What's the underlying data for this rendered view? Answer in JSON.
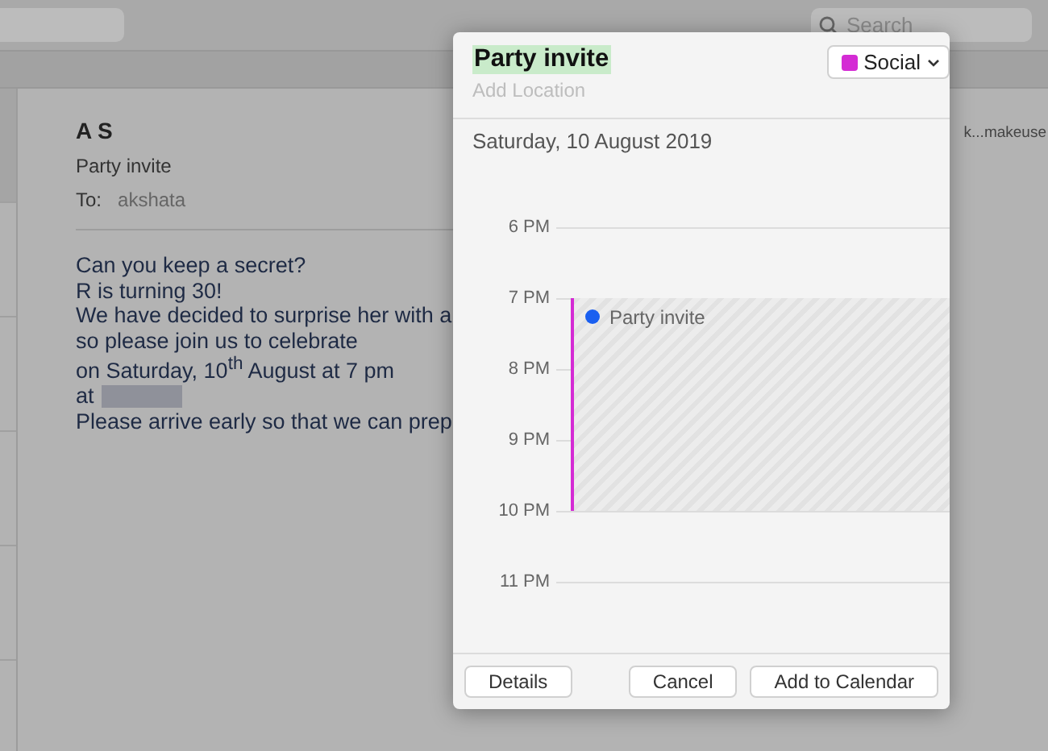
{
  "toolbar": {
    "search": {
      "placeholder": "Search"
    }
  },
  "message": {
    "sender": "A S",
    "subject": "Party invite",
    "to_label": "To:",
    "to": "akshata",
    "side_text": "k...makeuse",
    "body": [
      "Can you keep a secret?",
      "R is turning 30!",
      "We have decided to surprise her with a",
      "so please join us to celebrate",
      "on Saturday, 10$^{th}$ August at 7 pm",
      "at",
      "Please arrive early so that we can prep"
    ]
  },
  "popover": {
    "title": "Party invite",
    "title_selected": true,
    "location": {
      "placeholder": "Add Location"
    },
    "calendar": {
      "label": "Social",
      "color": "#d42bd4"
    },
    "date": "Saturday, 10 August 2019",
    "hours": [
      "6 PM",
      "7 PM",
      "8 PM",
      "9 PM",
      "10 PM",
      "11 PM"
    ],
    "event": {
      "title": "Party invite",
      "color": "#1a5ff0"
    },
    "buttons": {
      "left": "Details",
      "cancel": "Cancel",
      "confirm": "Add to Calendar"
    }
  }
}
